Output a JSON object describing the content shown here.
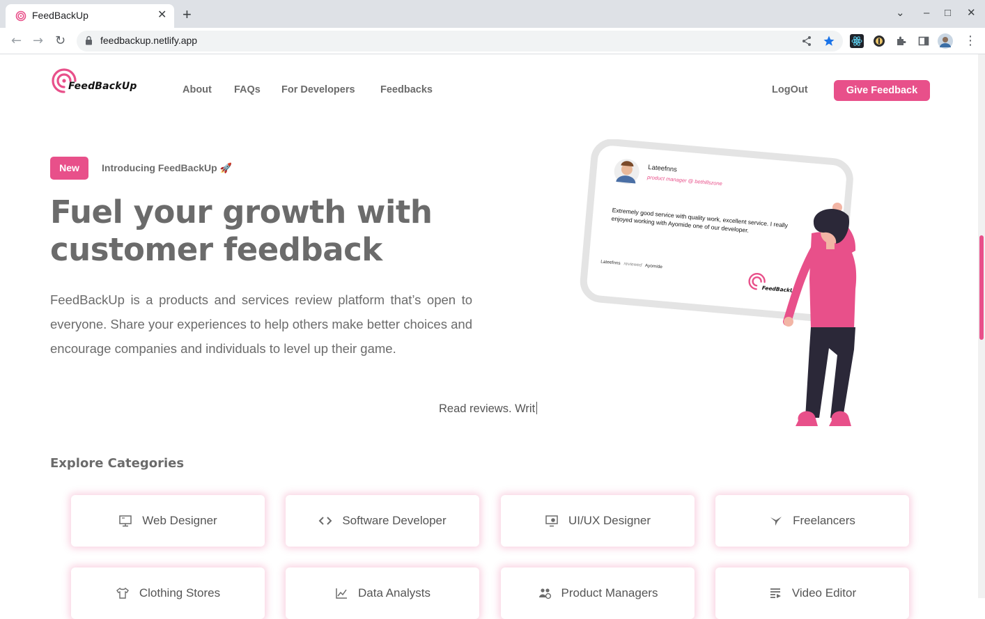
{
  "browser": {
    "tab_title": "FeedBackUp",
    "tab_close": "✕",
    "new_tab": "+",
    "url": "feedbackup.netlify.app",
    "window_controls": {
      "dropdown": "⌄",
      "minimize": "–",
      "maximize": "□",
      "close": "✕"
    },
    "nav": {
      "back": "←",
      "forward": "→",
      "reload": "↻",
      "menu": "⋮"
    },
    "icons": [
      "lock-icon",
      "share-icon",
      "bookmark-star-icon",
      "react-devtools-icon",
      "extension-icon",
      "puzzle-icon",
      "side-panel-icon",
      "profile-avatar"
    ]
  },
  "site": {
    "logo_text": "FeedBackUp",
    "nav_links": [
      "About",
      "FAQs",
      "For Developers",
      "Feedbacks"
    ],
    "logout": "LogOut",
    "cta": "Give Feedback",
    "accent_color": "#e8508a"
  },
  "hero": {
    "badge": "New",
    "intro": "Introducing FeedBackUp 🚀",
    "title_line1": "Fuel your growth with",
    "title_line2": "customer feedback",
    "description": "FeedBackUp is a products and services review platform that’s open to everyone. Share your experiences to help others make better choices and encourage companies and individuals to level up their game.",
    "typed": "Read reviews. Writ"
  },
  "review_card": {
    "name": "Lateefnns",
    "role": "product manager @ bethillszone",
    "text_line1": "Extremely good service with quality work, excellent service. I really",
    "text_line2": "enjoyed working with Ayomide one of our developer.",
    "footer_reviewer": "Lateefnns",
    "footer_verb": "reviewed",
    "footer_target": "Ayomide",
    "logo_text": "FeedBackUp"
  },
  "categories": {
    "title": "Explore Categories",
    "items": [
      {
        "label": "Web Designer",
        "icon": "monitor-icon"
      },
      {
        "label": "Software Developer",
        "icon": "code-icon"
      },
      {
        "label": "UI/UX Designer",
        "icon": "screen-design-icon"
      },
      {
        "label": "Freelancers",
        "icon": "bird-icon"
      },
      {
        "label": "Clothing Stores",
        "icon": "shirt-icon"
      },
      {
        "label": "Data Analysts",
        "icon": "chart-icon"
      },
      {
        "label": "Product Managers",
        "icon": "people-icon"
      },
      {
        "label": "Video Editor",
        "icon": "video-list-icon"
      }
    ]
  }
}
